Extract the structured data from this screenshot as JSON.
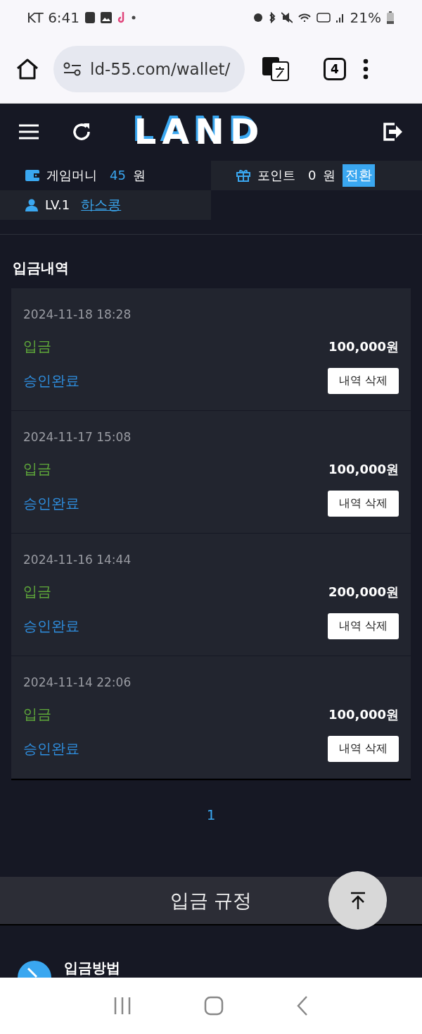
{
  "status_bar": {
    "carrier_time": "KT 6:41",
    "battery": "21%"
  },
  "browser": {
    "url": "ld-55.com/wallet/",
    "tab_count": "4"
  },
  "header": {
    "logo": "LAND"
  },
  "account": {
    "money_label": "게임머니",
    "money_value": "45",
    "money_unit": "원",
    "points_label": "포인트",
    "points_value": "0",
    "points_unit": "원",
    "convert_button": "전환",
    "level": "LV.1",
    "username": "하스콩"
  },
  "deposits": {
    "title": "입금내역",
    "items": [
      {
        "date": "2024-11-18 18:28",
        "type": "입금",
        "amount": "100,000원",
        "status": "승인완료",
        "delete_button": "내역 삭제"
      },
      {
        "date": "2024-11-17 15:08",
        "type": "입금",
        "amount": "100,000원",
        "status": "승인완료",
        "delete_button": "내역 삭제"
      },
      {
        "date": "2024-11-16 14:44",
        "type": "입금",
        "amount": "200,000원",
        "status": "승인완료",
        "delete_button": "내역 삭제"
      },
      {
        "date": "2024-11-14 22:06",
        "type": "입금",
        "amount": "100,000원",
        "status": "승인완료",
        "delete_button": "내역 삭제"
      }
    ]
  },
  "pagination": [
    {
      "label": "1",
      "selected": true
    }
  ],
  "rules": {
    "title": "입금 규정"
  },
  "method": {
    "title": "입금방법"
  }
}
